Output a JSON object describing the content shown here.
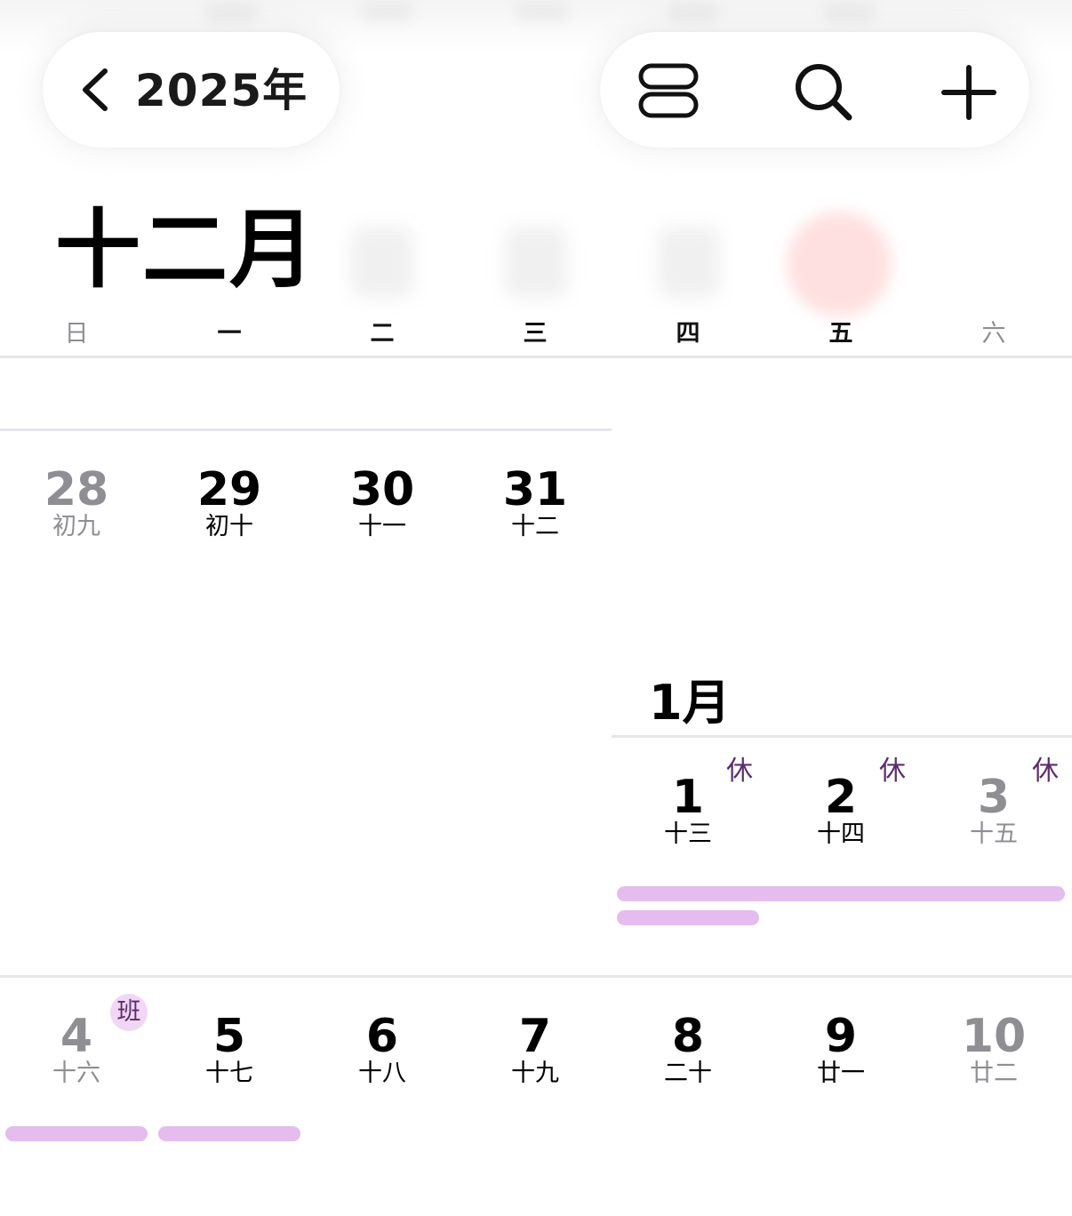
{
  "header": {
    "back_icon": "chevron-left-icon",
    "year_label": "2025年",
    "actions": [
      {
        "name": "view-toggle-button",
        "icon": "view-toggle-icon"
      },
      {
        "name": "search-button",
        "icon": "search-icon"
      },
      {
        "name": "add-event-button",
        "icon": "plus-icon"
      }
    ]
  },
  "month_title": "十二月",
  "weekdays": [
    "日",
    "一",
    "二",
    "三",
    "四",
    "五",
    "六"
  ],
  "weeks": [
    {
      "days": [
        {
          "num": "28",
          "lunar": "初九",
          "tone": "gray"
        },
        {
          "num": "29",
          "lunar": "初十",
          "tone": "dark"
        },
        {
          "num": "30",
          "lunar": "十一",
          "tone": "dark"
        },
        {
          "num": "31",
          "lunar": "十二",
          "tone": "dark"
        }
      ]
    },
    {
      "month_label": "1月",
      "days": [
        {
          "num": "1",
          "lunar": "十三",
          "tone": "dark",
          "tag": "休"
        },
        {
          "num": "2",
          "lunar": "十四",
          "tone": "dark",
          "tag": "休"
        },
        {
          "num": "3",
          "lunar": "十五",
          "tone": "gray",
          "tag": "休"
        }
      ]
    },
    {
      "days": [
        {
          "num": "4",
          "lunar": "十六",
          "tone": "gray",
          "tag": "班"
        },
        {
          "num": "5",
          "lunar": "十七",
          "tone": "dark"
        },
        {
          "num": "6",
          "lunar": "十八",
          "tone": "dark"
        },
        {
          "num": "7",
          "lunar": "十九",
          "tone": "dark"
        },
        {
          "num": "8",
          "lunar": "二十",
          "tone": "dark"
        },
        {
          "num": "9",
          "lunar": "廿一",
          "tone": "dark"
        },
        {
          "num": "10",
          "lunar": "廿二",
          "tone": "gray"
        }
      ]
    }
  ],
  "colors": {
    "event_bar": "#e4bcee",
    "holiday_tag": "#5b2d6e",
    "work_badge_bg": "#f1d7f4",
    "today_highlight": "#ffe0e0",
    "divider": "#e5e5ea"
  }
}
